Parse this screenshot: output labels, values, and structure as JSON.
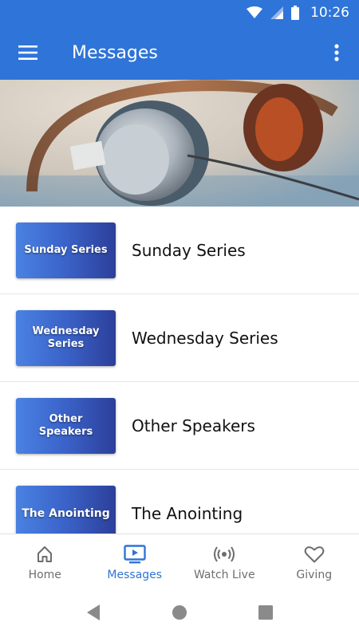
{
  "status_bar": {
    "time": "10:26"
  },
  "app_bar": {
    "title": "Messages"
  },
  "list": [
    {
      "thumb_text": "Sunday Series",
      "label": "Sunday Series"
    },
    {
      "thumb_text": "Wednesday Series",
      "label": "Wednesday Series"
    },
    {
      "thumb_text": "Other Speakers",
      "label": "Other Speakers"
    },
    {
      "thumb_text": "The Anointing",
      "label": "The Anointing"
    }
  ],
  "bottom_nav": [
    {
      "label": "Home",
      "icon": "home-icon"
    },
    {
      "label": "Messages",
      "icon": "tv-play-icon",
      "active": true
    },
    {
      "label": "Watch Live",
      "icon": "broadcast-icon"
    },
    {
      "label": "Giving",
      "icon": "heart-icon"
    }
  ],
  "colors": {
    "primary": "#2f74d8",
    "inactive": "#6d6d6d"
  }
}
